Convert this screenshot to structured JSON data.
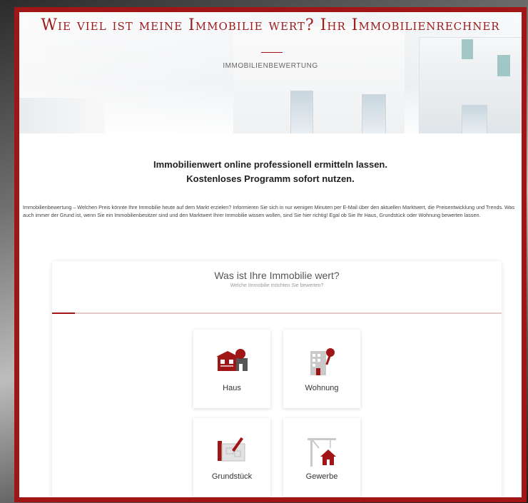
{
  "hero": {
    "title": "Wie viel ist meine Immobilie wert? Ihr Immobilienrechner",
    "subtitle": "IMMOBILIENBEWERTUNG"
  },
  "intro": {
    "headline_1": "Immobilienwert online professionell ermitteln lassen.",
    "headline_2": "Kostenloses Programm sofort nutzen.",
    "body": "Immobilienbewertung – Welchen Preis könnte Ihre Immobilie heute auf dem Markt erzielen? Informieren Sie sich in nur wenigen Minuten per E-Mail über den aktuellen Marktwert, die Preisentwicklung und Trends. Was auch immer der Grund ist, wenn Sie ein Immobilienbesitzer sind und den Marktwert Ihrer Immobilie wissen wollen, sind Sie hier richtig! Egal ob Sie Ihr Haus, Grundstück oder Wohnung bewerten lassen."
  },
  "calculator": {
    "title": "Was ist Ihre Immobilie wert?",
    "subtitle": "Welche Immobilie möchten Sie bewerten?",
    "progress": 0.05,
    "options": [
      {
        "label": "Haus",
        "icon": "house-icon"
      },
      {
        "label": "Wohnung",
        "icon": "apartment-icon"
      },
      {
        "label": "Grundstück",
        "icon": "land-plot-icon"
      },
      {
        "label": "Gewerbe",
        "icon": "commercial-crane-icon"
      }
    ]
  },
  "colors": {
    "accent": "#a01515",
    "frame": "#a01515"
  }
}
